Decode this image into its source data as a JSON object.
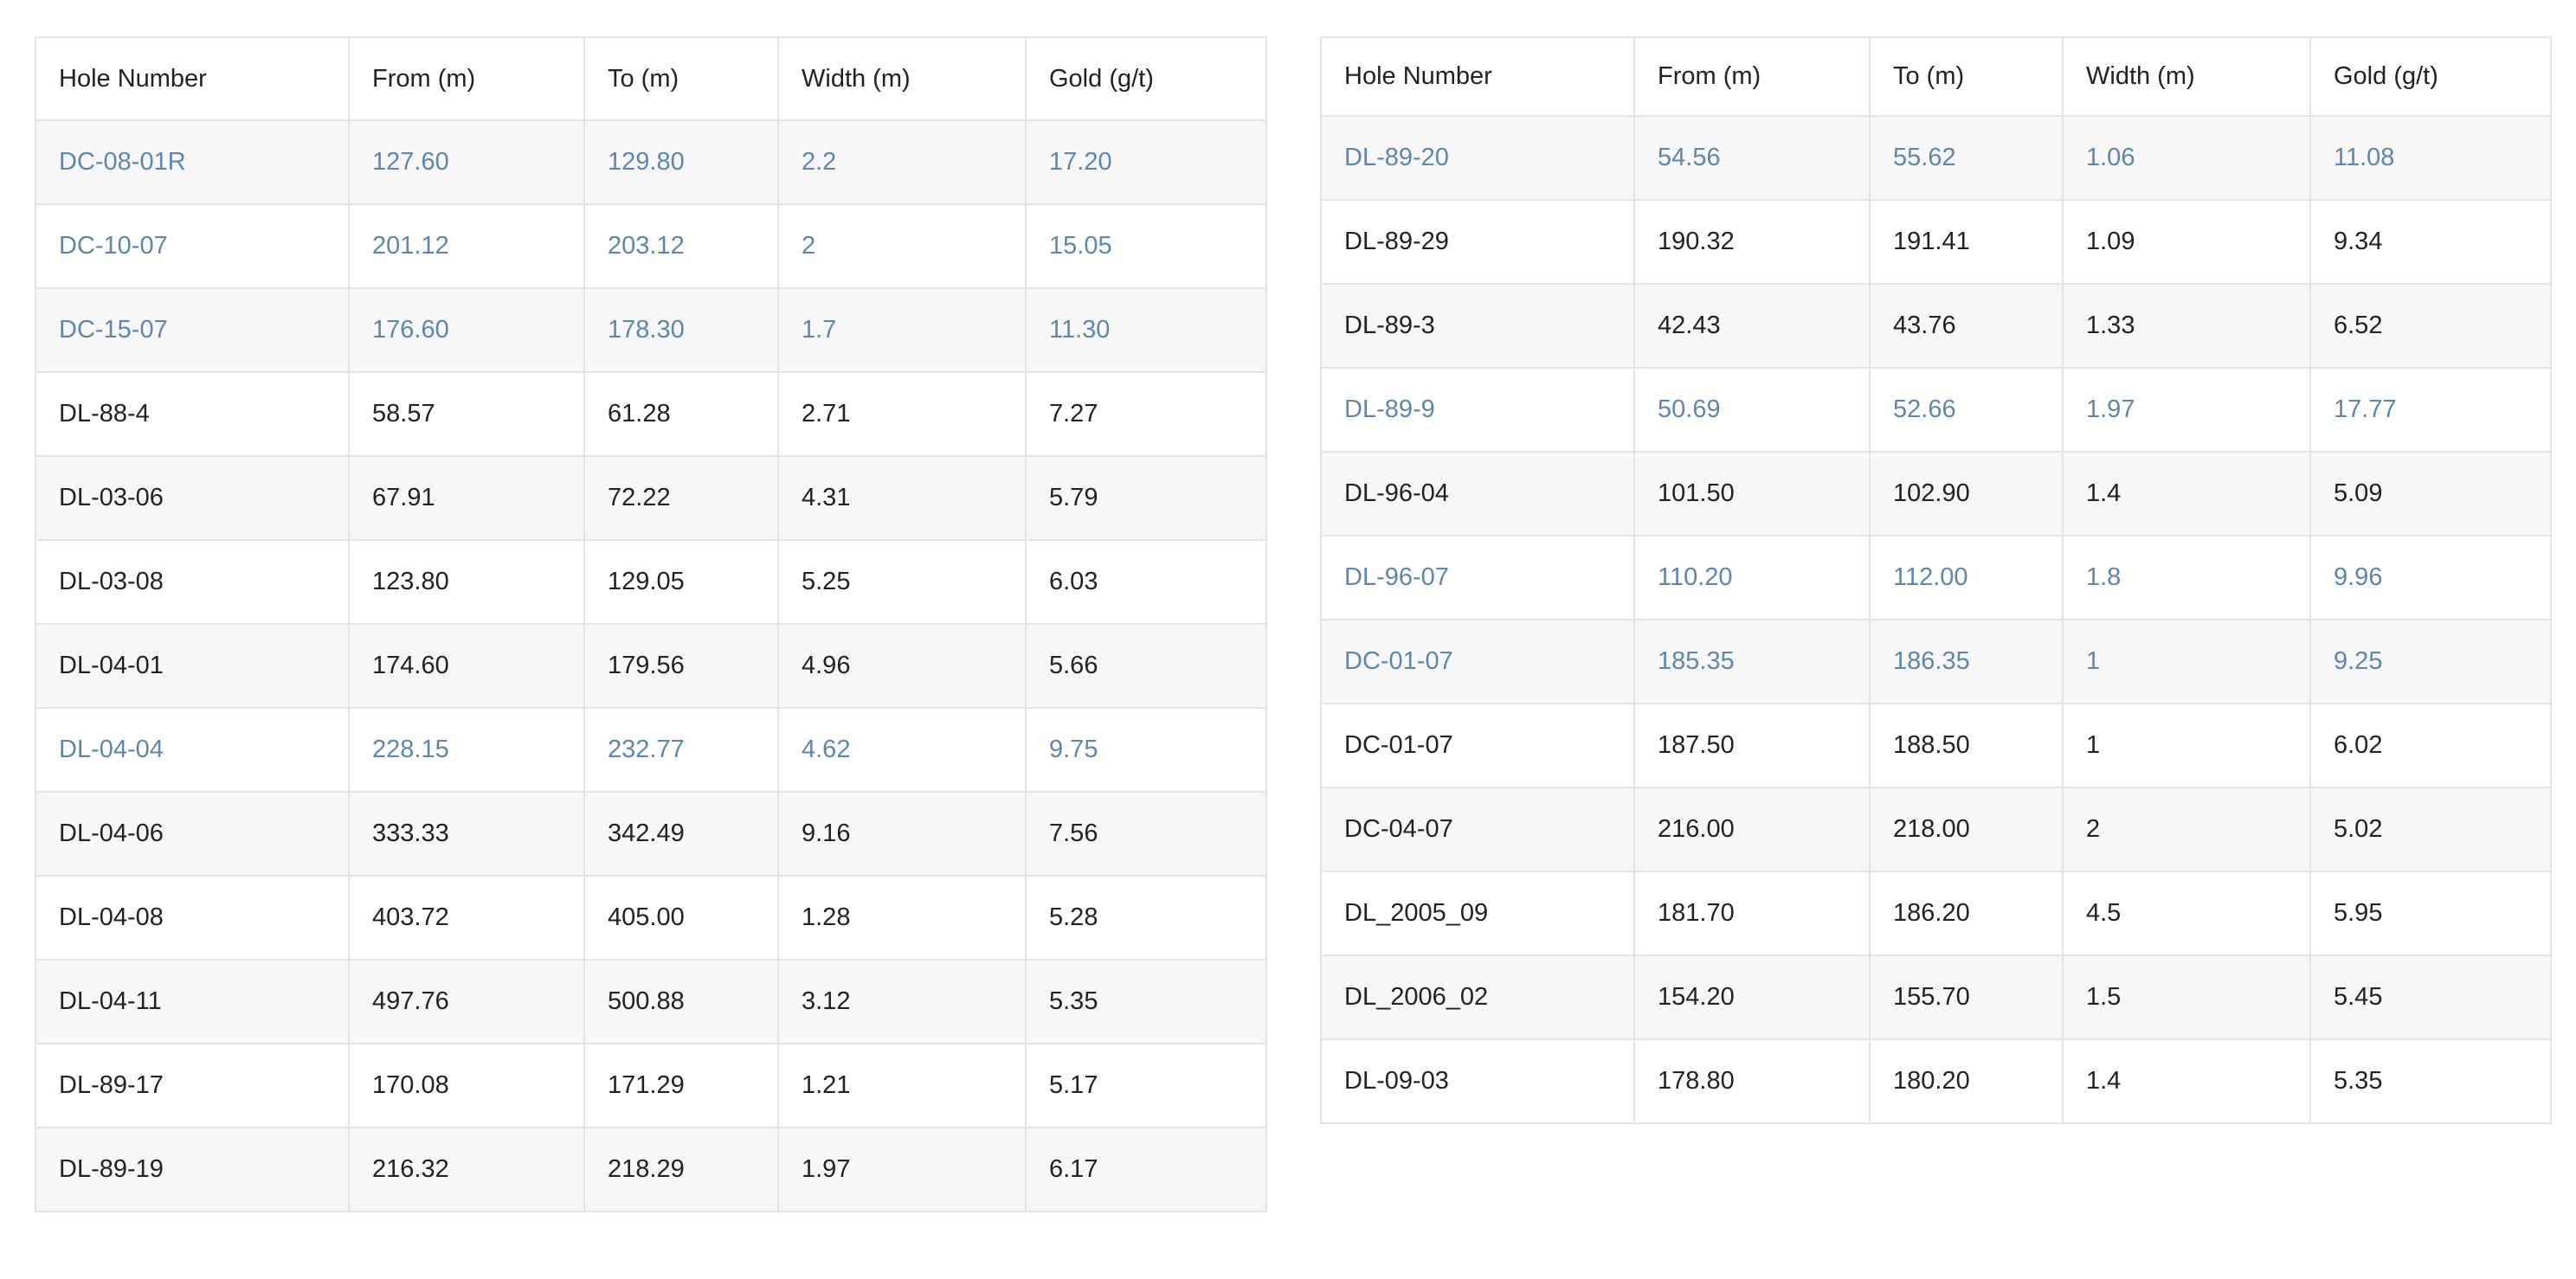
{
  "headers": [
    "Hole Number",
    "From (m)",
    "To (m)",
    "Width (m)",
    "Gold (g/t)"
  ],
  "left_table": {
    "rows": [
      {
        "hole": "DC-08-01R",
        "from": "127.60",
        "to": "129.80",
        "width": "2.2",
        "gold": "17.20",
        "highlight": true
      },
      {
        "hole": "DC-10-07",
        "from": "201.12",
        "to": "203.12",
        "width": "2",
        "gold": "15.05",
        "highlight": true
      },
      {
        "hole": "DC-15-07",
        "from": "176.60",
        "to": "178.30",
        "width": "1.7",
        "gold": "11.30",
        "highlight": true
      },
      {
        "hole": "DL-88-4",
        "from": "58.57",
        "to": "61.28",
        "width": "2.71",
        "gold": "7.27",
        "highlight": false
      },
      {
        "hole": "DL-03-06",
        "from": "67.91",
        "to": "72.22",
        "width": "4.31",
        "gold": "5.79",
        "highlight": false
      },
      {
        "hole": "DL-03-08",
        "from": "123.80",
        "to": "129.05",
        "width": "5.25",
        "gold": "6.03",
        "highlight": false
      },
      {
        "hole": "DL-04-01",
        "from": "174.60",
        "to": "179.56",
        "width": "4.96",
        "gold": "5.66",
        "highlight": false
      },
      {
        "hole": "DL-04-04",
        "from": "228.15",
        "to": "232.77",
        "width": "4.62",
        "gold": "9.75",
        "highlight": true
      },
      {
        "hole": "DL-04-06",
        "from": "333.33",
        "to": "342.49",
        "width": "9.16",
        "gold": "7.56",
        "highlight": false
      },
      {
        "hole": "DL-04-08",
        "from": "403.72",
        "to": "405.00",
        "width": "1.28",
        "gold": "5.28",
        "highlight": false
      },
      {
        "hole": "DL-04-11",
        "from": "497.76",
        "to": "500.88",
        "width": "3.12",
        "gold": "5.35",
        "highlight": false
      },
      {
        "hole": "DL-89-17",
        "from": "170.08",
        "to": "171.29",
        "width": "1.21",
        "gold": "5.17",
        "highlight": false
      },
      {
        "hole": "DL-89-19",
        "from": "216.32",
        "to": "218.29",
        "width": "1.97",
        "gold": "6.17",
        "highlight": false
      }
    ]
  },
  "right_table": {
    "rows": [
      {
        "hole": "DL-89-20",
        "from": "54.56",
        "to": "55.62",
        "width": "1.06",
        "gold": "11.08",
        "highlight": true
      },
      {
        "hole": "DL-89-29",
        "from": "190.32",
        "to": "191.41",
        "width": "1.09",
        "gold": "9.34",
        "highlight": false
      },
      {
        "hole": "DL-89-3",
        "from": "42.43",
        "to": "43.76",
        "width": "1.33",
        "gold": "6.52",
        "highlight": false
      },
      {
        "hole": "DL-89-9",
        "from": "50.69",
        "to": "52.66",
        "width": "1.97",
        "gold": "17.77",
        "highlight": true
      },
      {
        "hole": "DL-96-04",
        "from": "101.50",
        "to": "102.90",
        "width": "1.4",
        "gold": "5.09",
        "highlight": false
      },
      {
        "hole": "DL-96-07",
        "from": "110.20",
        "to": "112.00",
        "width": "1.8",
        "gold": "9.96",
        "highlight": true
      },
      {
        "hole": "DC-01-07",
        "from": "185.35",
        "to": "186.35",
        "width": "1",
        "gold": "9.25",
        "highlight": true
      },
      {
        "hole": "DC-01-07",
        "from": "187.50",
        "to": "188.50",
        "width": "1",
        "gold": "6.02",
        "highlight": false
      },
      {
        "hole": "DC-04-07",
        "from": "216.00",
        "to": "218.00",
        "width": "2",
        "gold": "5.02",
        "highlight": false
      },
      {
        "hole": "DL_2005_09",
        "from": "181.70",
        "to": "186.20",
        "width": "4.5",
        "gold": "5.95",
        "highlight": false
      },
      {
        "hole": "DL_2006_02",
        "from": "154.20",
        "to": "155.70",
        "width": "1.5",
        "gold": "5.45",
        "highlight": false
      },
      {
        "hole": "DL-09-03",
        "from": "178.80",
        "to": "180.20",
        "width": "1.4",
        "gold": "5.35",
        "highlight": false
      }
    ]
  },
  "colors": {
    "highlight_text": "#5e86ad",
    "normal_text": "#222222",
    "stripe_background": "#f7f7f7",
    "border": "#e3e3e3"
  }
}
